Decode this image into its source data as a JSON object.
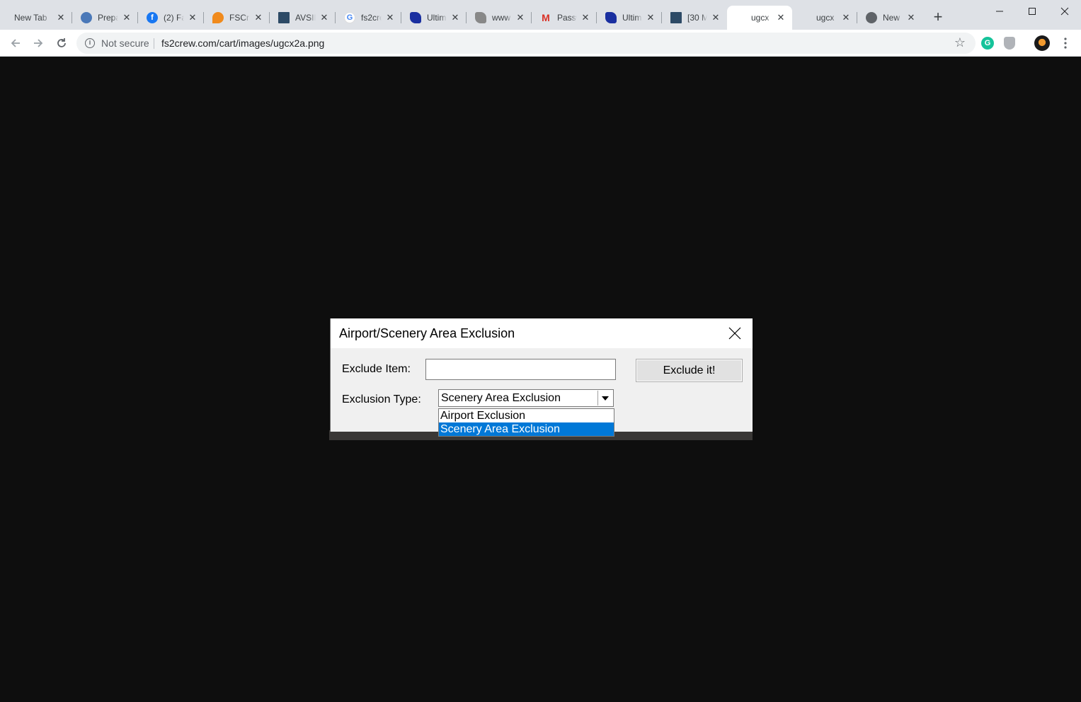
{
  "browser": {
    "tabs": [
      {
        "label": "New Tab",
        "icon": "none",
        "active": false
      },
      {
        "label": "Prepare",
        "icon": "globe",
        "active": false
      },
      {
        "label": "(2) Facebook",
        "icon": "facebook",
        "active": false
      },
      {
        "label": "FSCrew",
        "icon": "fscrew",
        "active": false
      },
      {
        "label": "AVSIM",
        "icon": "avsim",
        "active": false
      },
      {
        "label": "fs2crew",
        "icon": "google",
        "active": false
      },
      {
        "label": "Ultimate",
        "icon": "ultimate",
        "active": false
      },
      {
        "label": "www",
        "icon": "ultimate-gray",
        "active": false
      },
      {
        "label": "Password",
        "icon": "gmail",
        "active": false
      },
      {
        "label": "Ultimate",
        "icon": "ultimate",
        "active": false
      },
      {
        "label": "[30 M",
        "icon": "avsim",
        "active": false
      },
      {
        "label": "ugcx",
        "icon": "none",
        "active": true
      },
      {
        "label": "ugcx",
        "icon": "none",
        "active": false
      },
      {
        "label": "New",
        "icon": "globe-gray",
        "active": false
      }
    ],
    "security_label": "Not secure",
    "url": "fs2crew.com/cart/images/ugcx2a.png",
    "colors": {
      "accent": "#0078d7",
      "page_bg": "#0e0e0e",
      "tabstrip_bg": "#dee1e6"
    }
  },
  "dialog": {
    "title": "Airport/Scenery Area Exclusion",
    "exclude_item_label": "Exclude Item:",
    "exclude_item_value": "",
    "exclude_button": "Exclude it!",
    "exclusion_type_label": "Exclusion Type:",
    "exclusion_type_value": "Scenery Area Exclusion",
    "options": [
      "Airport Exclusion",
      "Scenery Area Exclusion"
    ],
    "selected_index": 1
  }
}
